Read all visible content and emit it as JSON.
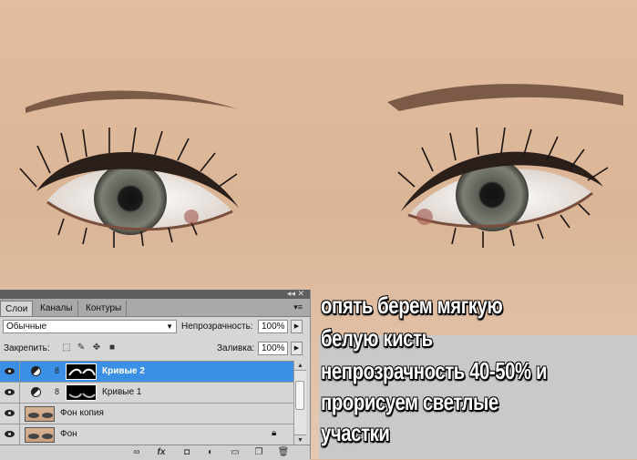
{
  "caption": {
    "lines": [
      "опять берем мягкую",
      "белую кисть",
      "непрозрачность 40-50% и",
      "прорисуем светлые",
      "участки"
    ]
  },
  "panel": {
    "tabs": [
      {
        "label": "Слои",
        "active": true
      },
      {
        "label": "Каналы",
        "active": false
      },
      {
        "label": "Контуры",
        "active": false
      }
    ],
    "blend_mode": "Обычные",
    "opacity_label": "Непрозрачность:",
    "opacity_value": "100%",
    "lock_label": "Закрепить:",
    "fill_label": "Заливка:",
    "fill_value": "100%",
    "layers": [
      {
        "name": "Кривые 2",
        "type": "curves-adjustment",
        "visible": true,
        "selected": true
      },
      {
        "name": "Кривые 1",
        "type": "curves-adjustment",
        "visible": true,
        "selected": false
      },
      {
        "name": "Фон копия",
        "type": "image",
        "visible": true,
        "selected": false
      },
      {
        "name": "Фон",
        "type": "image",
        "visible": true,
        "selected": false,
        "locked": true
      }
    ],
    "bottom_icons": [
      "link-icon",
      "fx-icon",
      "mask-icon",
      "adjustment-icon",
      "group-folder-icon",
      "new-layer-icon",
      "trash-icon"
    ]
  },
  "colors": {
    "skin": "#d9b9a0",
    "selection": "#3b8fe6",
    "caption_bg": "#c9c9c9"
  }
}
